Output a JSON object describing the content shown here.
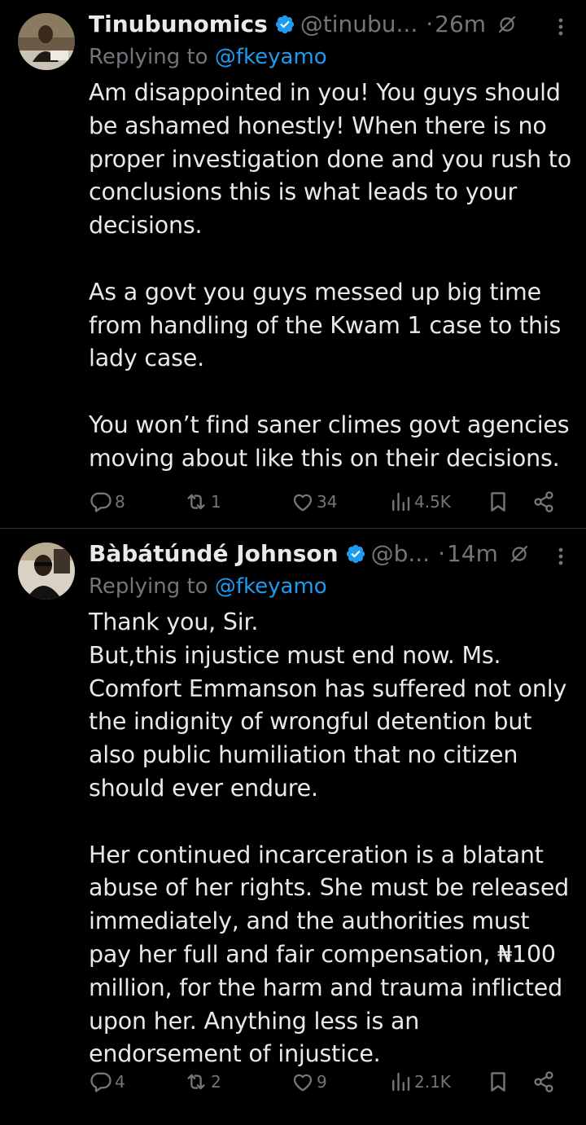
{
  "colors": {
    "background": "#000000",
    "text": "#e7e9ea",
    "secondary": "#71767b",
    "link": "#1d9bf0",
    "verified": "#1d9bf0",
    "divider": "#2f3336"
  },
  "tweets": [
    {
      "name": "Tinubunomics",
      "handle": "@tinubu...",
      "dot": "·",
      "time": "26m",
      "replying_prefix": "Replying to ",
      "replying_to": "@fkeyamo",
      "paragraphs": [
        "Am disappointed in you! You guys should be ashamed honestly! When there is no proper investigation done and  you rush to conclusions this is what leads to your decisions.",
        "As a govt you guys messed up big time from handling of the Kwam 1 case to this lady case.",
        "You won’t find saner climes govt agencies moving about like this on their decisions."
      ],
      "stats": {
        "replies": "8",
        "reposts": "1",
        "likes": "34",
        "views": "4.5K"
      }
    },
    {
      "name": "Bàbátúndé Johnson",
      "handle": "@b...",
      "dot": "·",
      "time": "14m",
      "replying_prefix": "Replying to ",
      "replying_to": "@fkeyamo",
      "paragraphs": [
        "Thank you, Sir.\nBut,this injustice must end now. Ms. Comfort Emmanson has suffered not only the indignity of wrongful detention but also public humiliation that no citizen should ever endure.",
        "Her continued incarceration is a blatant abuse of her rights. She must be released immediately, and the authorities must pay her full and fair compensation, ₦100 million, for the harm and trauma inflicted upon her. Anything less is an endorsement of injustice."
      ],
      "stats": {
        "replies": "4",
        "reposts": "2",
        "likes": "9",
        "views": "2.1K"
      }
    }
  ],
  "icons": {
    "verified": "verified-badge-icon",
    "grok": "grok-icon",
    "more": "more-options-icon",
    "reply": "reply-icon",
    "repost": "repost-icon",
    "like": "heart-icon",
    "views": "views-icon",
    "bookmark": "bookmark-icon",
    "share": "share-icon"
  }
}
